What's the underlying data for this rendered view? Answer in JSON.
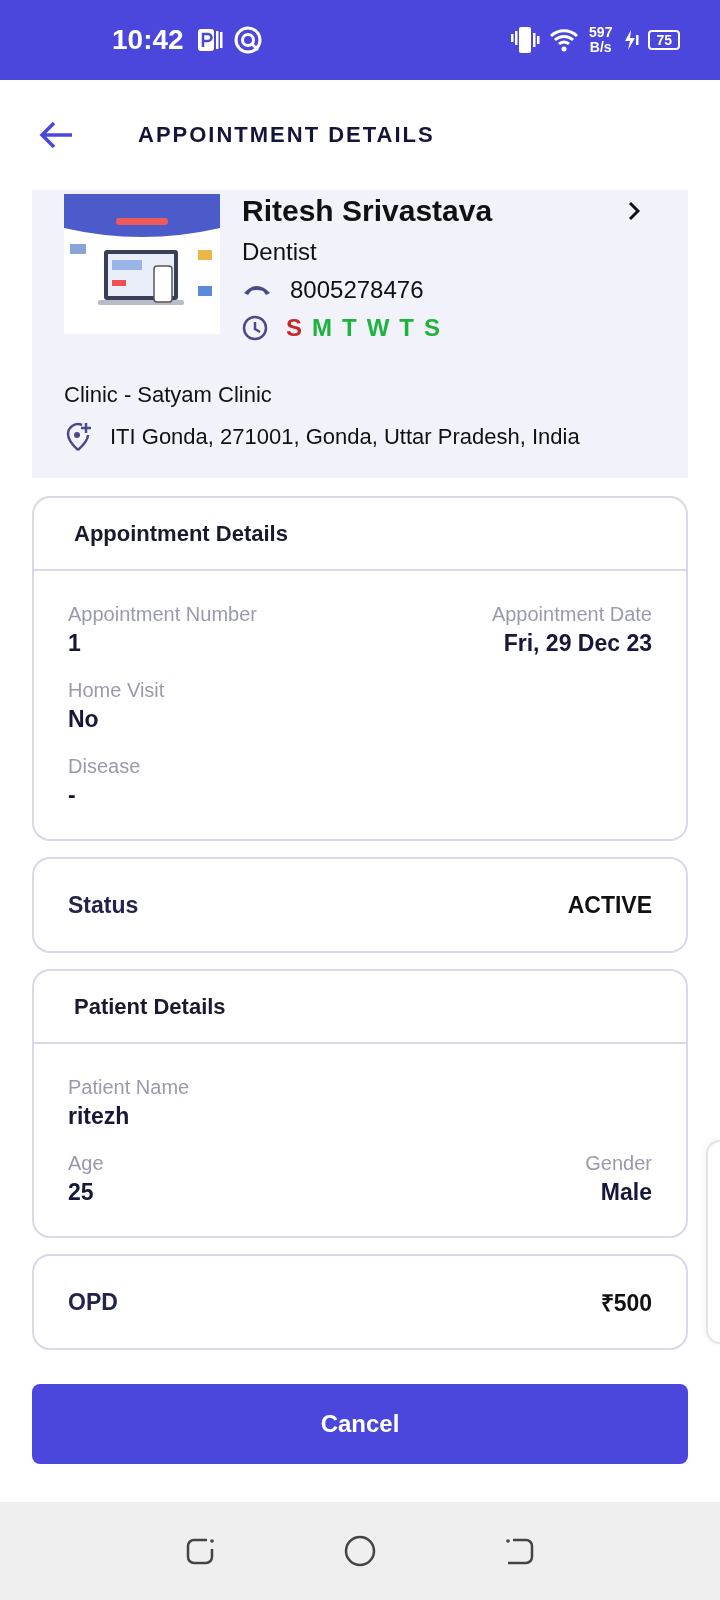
{
  "status_bar": {
    "time": "10:42",
    "net_speed": [
      "597",
      "B/s"
    ],
    "battery": "75"
  },
  "header": {
    "title": "APPOINTMENT DETAILS"
  },
  "doctor": {
    "name": "Ritesh Srivastava",
    "specialty": "Dentist",
    "phone": "8005278476",
    "days": [
      {
        "letter": "S",
        "color": "#c62828"
      },
      {
        "letter": "M",
        "color": "#1db33f"
      },
      {
        "letter": "T",
        "color": "#1db33f"
      },
      {
        "letter": "W",
        "color": "#1db33f"
      },
      {
        "letter": "T",
        "color": "#1db33f"
      },
      {
        "letter": "S",
        "color": "#1db33f"
      }
    ],
    "clinic": "Clinic - Satyam Clinic",
    "address": "ITI Gonda, 271001, Gonda, Uttar Pradesh, India"
  },
  "appointment_details": {
    "title": "Appointment Details",
    "rows": [
      [
        {
          "label": "Appointment Number",
          "value": "1"
        },
        {
          "label": "Appointment Date",
          "value": "Fri, 29 Dec 23"
        }
      ],
      [
        {
          "label": "Home Visit",
          "value": "No"
        }
      ],
      [
        {
          "label": "Disease",
          "value": "-"
        }
      ]
    ]
  },
  "status": {
    "label": "Status",
    "value": "ACTIVE"
  },
  "patient_details": {
    "title": "Patient Details",
    "rows": [
      [
        {
          "label": "Patient Name",
          "value": "ritezh"
        }
      ],
      [
        {
          "label": "Age",
          "value": "25"
        },
        {
          "label": "Gender",
          "value": "Male"
        }
      ]
    ]
  },
  "fee": {
    "label": "OPD",
    "value": "₹500"
  },
  "cancel_button": {
    "label": "Cancel"
  }
}
